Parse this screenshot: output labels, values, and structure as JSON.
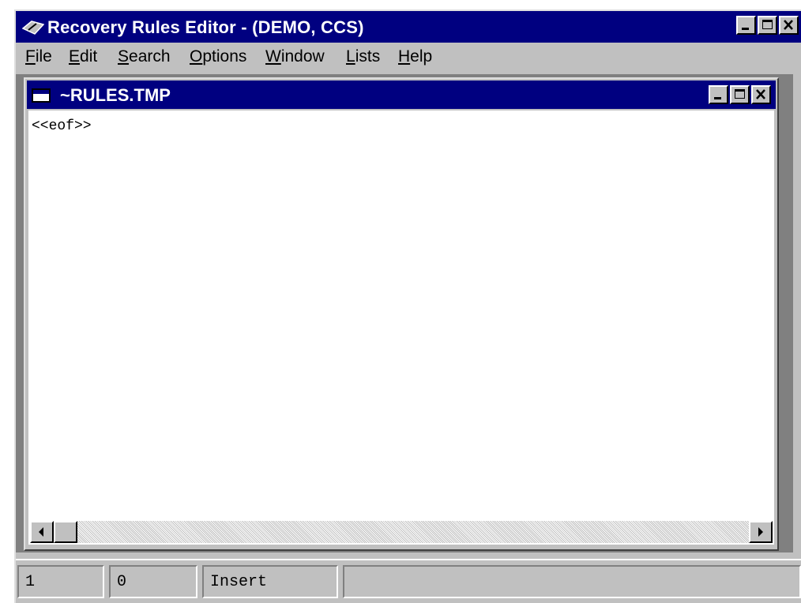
{
  "window": {
    "title": "Recovery Rules Editor - (DEMO, CCS)"
  },
  "menu": {
    "items": [
      {
        "mn": "F",
        "rest": "ile"
      },
      {
        "mn": "E",
        "rest": "dit"
      },
      {
        "mn": "S",
        "rest": "earch"
      },
      {
        "mn": "O",
        "rest": "ptions"
      },
      {
        "mn": "W",
        "rest": "indow"
      },
      {
        "mn": "L",
        "rest": "ists"
      },
      {
        "mn": "H",
        "rest": "elp"
      }
    ]
  },
  "document": {
    "title": "~RULES.TMP",
    "content": "<<eof>>"
  },
  "status": {
    "line": "1",
    "column": "0",
    "mode": "Insert",
    "message": ""
  },
  "colors": {
    "titlebar": "#000080",
    "face": "#c0c0c0",
    "workspace": "#808080"
  }
}
